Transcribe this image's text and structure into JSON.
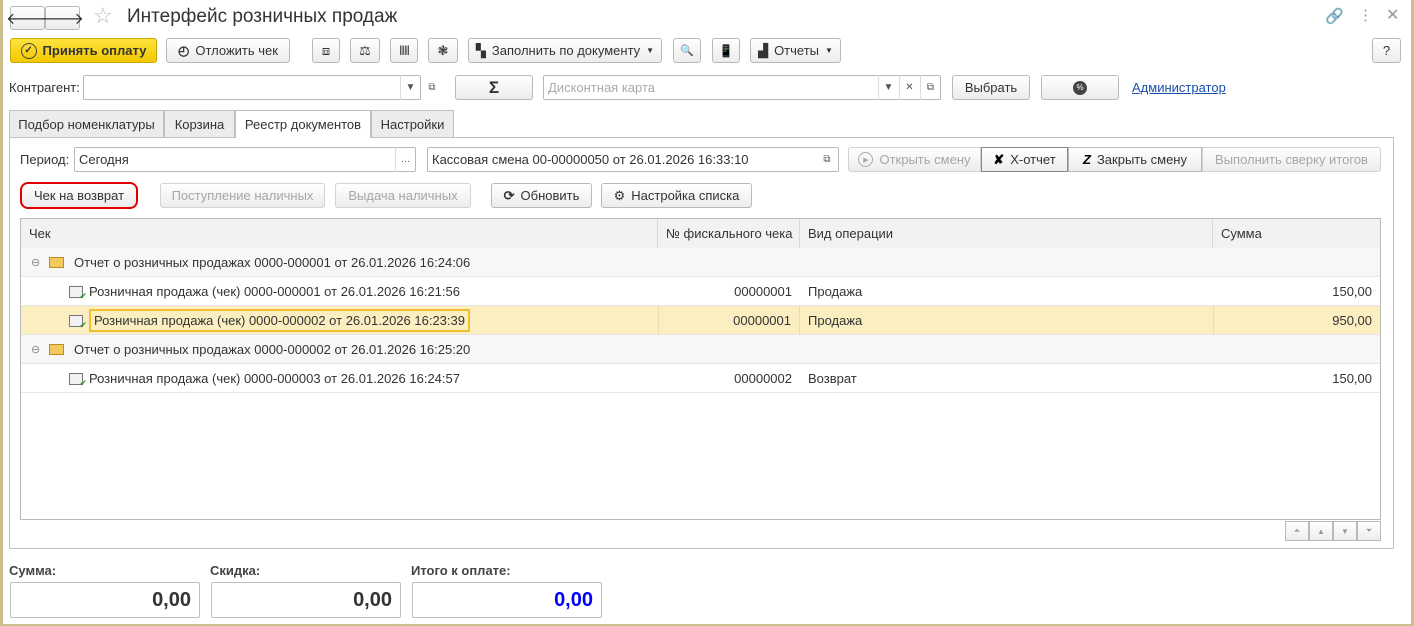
{
  "window": {
    "title": "Интерфейс розничных продаж",
    "help": "?"
  },
  "toolbar": {
    "accept_payment": "Принять оплату",
    "postpone": "Отложить чек",
    "fill_by_doc": "Заполнить по документу",
    "reports": "Отчеты"
  },
  "filters": {
    "counterparty_label": "Контрагент:",
    "counterparty_value": "",
    "sigma": "Σ",
    "discount_placeholder": "Дисконтная карта",
    "select": "Выбрать",
    "percent": "%",
    "user": "Администратор"
  },
  "tabs": [
    "Подбор номенклатуры",
    "Корзина",
    "Реестр документов",
    "Настройки"
  ],
  "registry": {
    "period_label": "Период:",
    "period_value": "Сегодня",
    "shift": "Кассовая смена 00-00000050 от 26.01.2026 16:33:10",
    "open_shift": "Открыть смену",
    "x_report": "X-отчет",
    "close_shift": "Закрыть смену",
    "reconcile": "Выполнить сверку итогов",
    "return_check": "Чек на возврат",
    "cash_in": "Поступление наличных",
    "cash_out": "Выдача наличных",
    "refresh": "Обновить",
    "list_settings": "Настройка списка"
  },
  "table": {
    "columns": [
      "Чек",
      "№ фискального чека",
      "Вид операции",
      "Сумма"
    ],
    "rows": [
      {
        "type": "group",
        "check": "Отчет о розничных продажах 0000-000001 от 26.01.2026 16:24:06",
        "fiscal": "",
        "operation": "",
        "sum": ""
      },
      {
        "type": "item",
        "check": "Розничная продажа (чек) 0000-000001 от 26.01.2026 16:21:56",
        "fiscal": "00000001",
        "operation": "Продажа",
        "sum": "150,00"
      },
      {
        "type": "item",
        "selected": true,
        "check": "Розничная продажа (чек) 0000-000002 от 26.01.2026 16:23:39",
        "fiscal": "00000001",
        "operation": "Продажа",
        "sum": "950,00"
      },
      {
        "type": "group",
        "check": "Отчет о розничных продажах 0000-000002 от 26.01.2026 16:25:20",
        "fiscal": "",
        "operation": "",
        "sum": ""
      },
      {
        "type": "item",
        "check": "Розничная продажа (чек) 0000-000003 от 26.01.2026 16:24:57",
        "fiscal": "00000002",
        "operation": "Возврат",
        "sum": "150,00"
      }
    ]
  },
  "totals": {
    "sum_label": "Сумма:",
    "sum": "0,00",
    "discount_label": "Скидка:",
    "discount": "0,00",
    "total_label": "Итого к оплате:",
    "total": "0,00"
  },
  "colors": {
    "accent_yellow": "#f5d000",
    "selection": "#fbeec0",
    "total_blue": "#0000ff",
    "highlight_red": "#e00000"
  }
}
